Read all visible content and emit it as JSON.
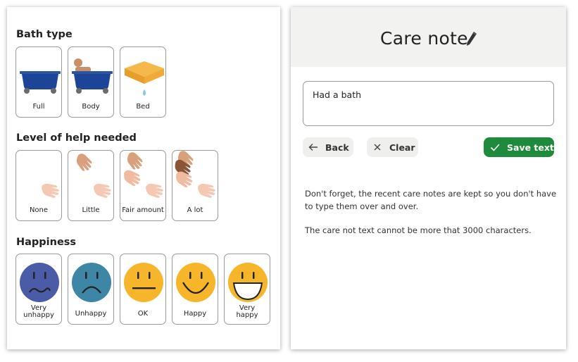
{
  "left_panel": {
    "bath_type": {
      "title": "Bath type",
      "options": [
        {
          "label": "Full",
          "icon": "full-bath-icon"
        },
        {
          "label": "Body",
          "icon": "body-bath-icon"
        },
        {
          "label": "Bed",
          "icon": "bed-bath-icon"
        }
      ]
    },
    "help_level": {
      "title": "Level of help needed",
      "options": [
        {
          "label": "None",
          "icon": "no-help-icon"
        },
        {
          "label": "Little",
          "icon": "little-help-icon"
        },
        {
          "label": "Fair amount",
          "icon": "fair-help-icon"
        },
        {
          "label": "A lot",
          "icon": "lot-help-icon"
        }
      ]
    },
    "happiness": {
      "title": "Happiness",
      "options": [
        {
          "label": "Very\nunhappy",
          "icon": "very-unhappy-face-icon",
          "color": "#4a5ca8"
        },
        {
          "label": "Unhappy",
          "icon": "unhappy-face-icon",
          "color": "#3d86a6"
        },
        {
          "label": "OK",
          "icon": "ok-face-icon",
          "color": "#f7b52a"
        },
        {
          "label": "Happy",
          "icon": "happy-face-icon",
          "color": "#f7b52a"
        },
        {
          "label": "Very\nhappy",
          "icon": "very-happy-face-icon",
          "color": "#f7b52a"
        }
      ]
    }
  },
  "care_note": {
    "title": "Care note",
    "note_value": "Had a bath",
    "buttons": {
      "back": "Back",
      "clear": "Clear",
      "save": "Save text"
    },
    "info_1": "Don't forget, the recent care notes are kept so you don't have to type them over and over.",
    "info_2": "The care not text cannot be more that 3000 characters.",
    "accent_color": "#1e8a3b"
  }
}
